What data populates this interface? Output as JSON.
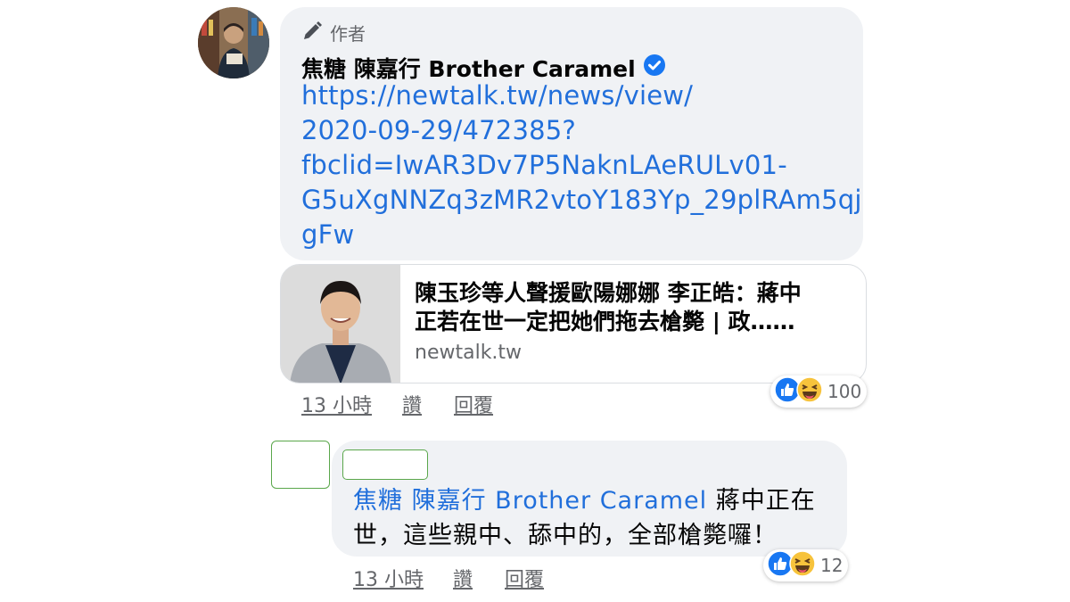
{
  "comment": {
    "author_label": "作者",
    "author_name": "焦糖 陳嘉行 Brother Caramel",
    "link_text": "https://newtalk.tw/news/view/\n2020-09-29/472385?\nfbclid=IwAR3Dv7P5NaknLAeRULv01-\nG5uXgNNZq3zMR2vtoY183Yp_29plRAm5qj\ngFw",
    "preview": {
      "title": "陳玉珍等人聲援歐陽娜娜 李正皓：蔣中\n正若在世一定把她們拖去槍斃 | 政……",
      "domain": "newtalk.tw"
    },
    "time": "13 小時",
    "like_label": "讚",
    "reply_label": "回覆",
    "reaction_count": "100"
  },
  "reply": {
    "mention": "焦糖 陳嘉行 Brother Caramel",
    "text": " 蔣中正在世，這些親中、舔中的，全部槍斃囉！",
    "time": "13 小時",
    "like_label": "讚",
    "reply_label": "回覆",
    "reaction_count": "12"
  },
  "colors": {
    "link": "#216fdb",
    "bubble": "#f0f2f5",
    "like_blue": "#1877f2",
    "verified": "#1877f2"
  }
}
